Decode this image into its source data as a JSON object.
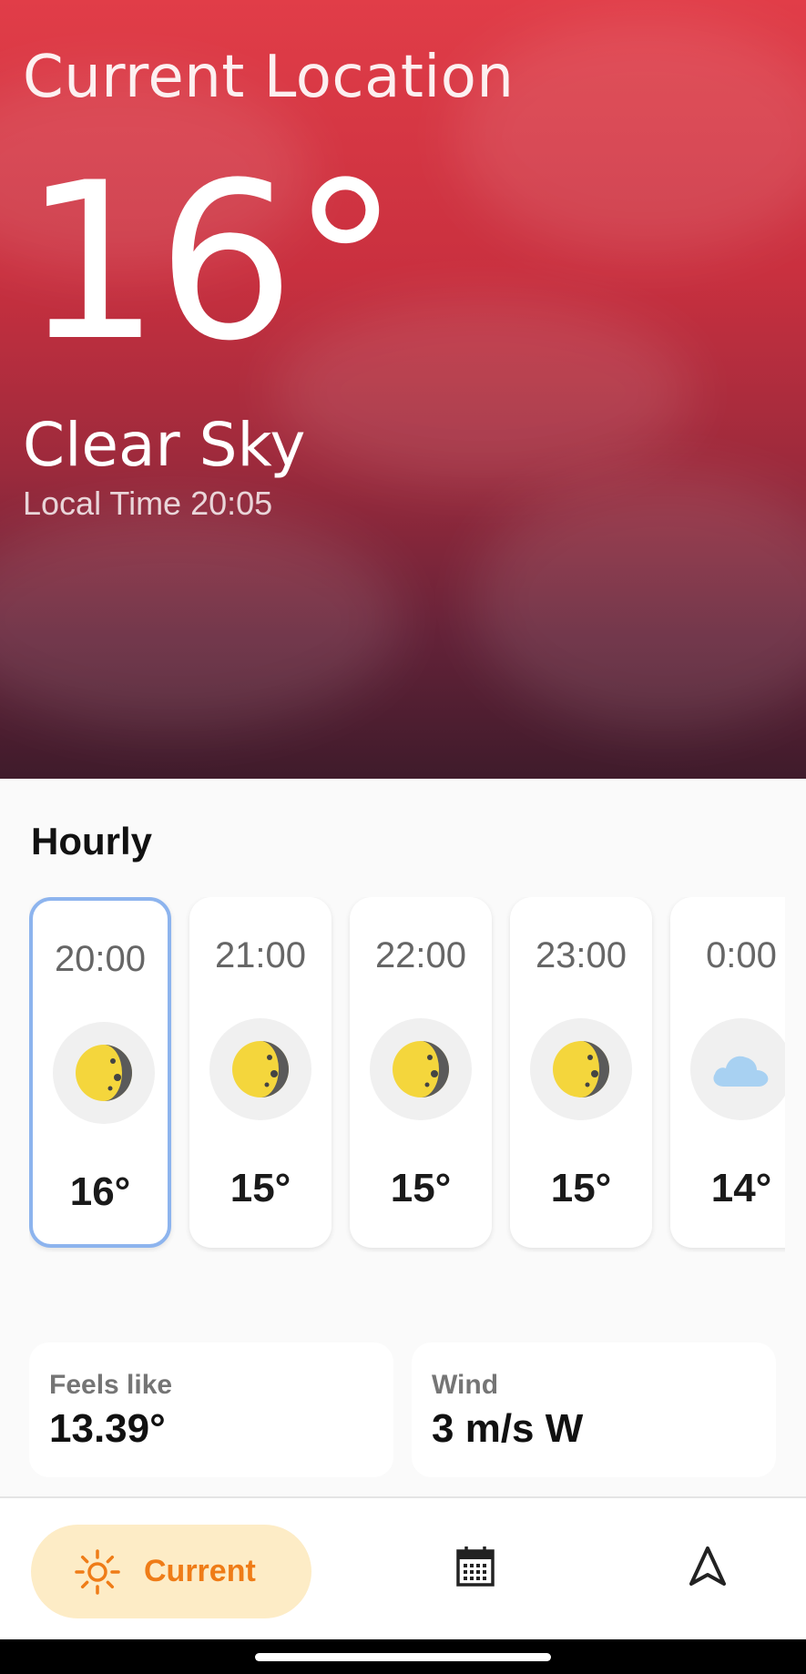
{
  "hero": {
    "location": "Current Location",
    "temperature": "16°",
    "condition": "Clear Sky",
    "local_time": "Local Time 20:05",
    "gradient_colors": [
      "#e13d48",
      "#c9303f",
      "#9c2a3c",
      "#632238",
      "#3f1b2b"
    ]
  },
  "hourly": {
    "title": "Hourly",
    "items": [
      {
        "time": "20:00",
        "icon": "moon-icon",
        "temp": "16°",
        "selected": true
      },
      {
        "time": "21:00",
        "icon": "moon-icon",
        "temp": "15°",
        "selected": false
      },
      {
        "time": "22:00",
        "icon": "moon-icon",
        "temp": "15°",
        "selected": false
      },
      {
        "time": "23:00",
        "icon": "moon-icon",
        "temp": "15°",
        "selected": false
      },
      {
        "time": "0:00",
        "icon": "cloud-icon",
        "temp": "14°",
        "selected": false
      }
    ]
  },
  "details": {
    "feels_like": {
      "label": "Feels like",
      "value": "13.39°"
    },
    "wind": {
      "label": "Wind",
      "value": "3 m/s W"
    }
  },
  "nav": {
    "current": {
      "label": "Current",
      "icon": "sun-icon",
      "active": true
    },
    "calendar": {
      "icon": "calendar-icon"
    },
    "location": {
      "icon": "navigation-arrow-icon"
    }
  },
  "colors": {
    "accent": "#ef7c17",
    "nav_active_bg": "#fdecc6",
    "selected_border": "#8db4ee"
  }
}
